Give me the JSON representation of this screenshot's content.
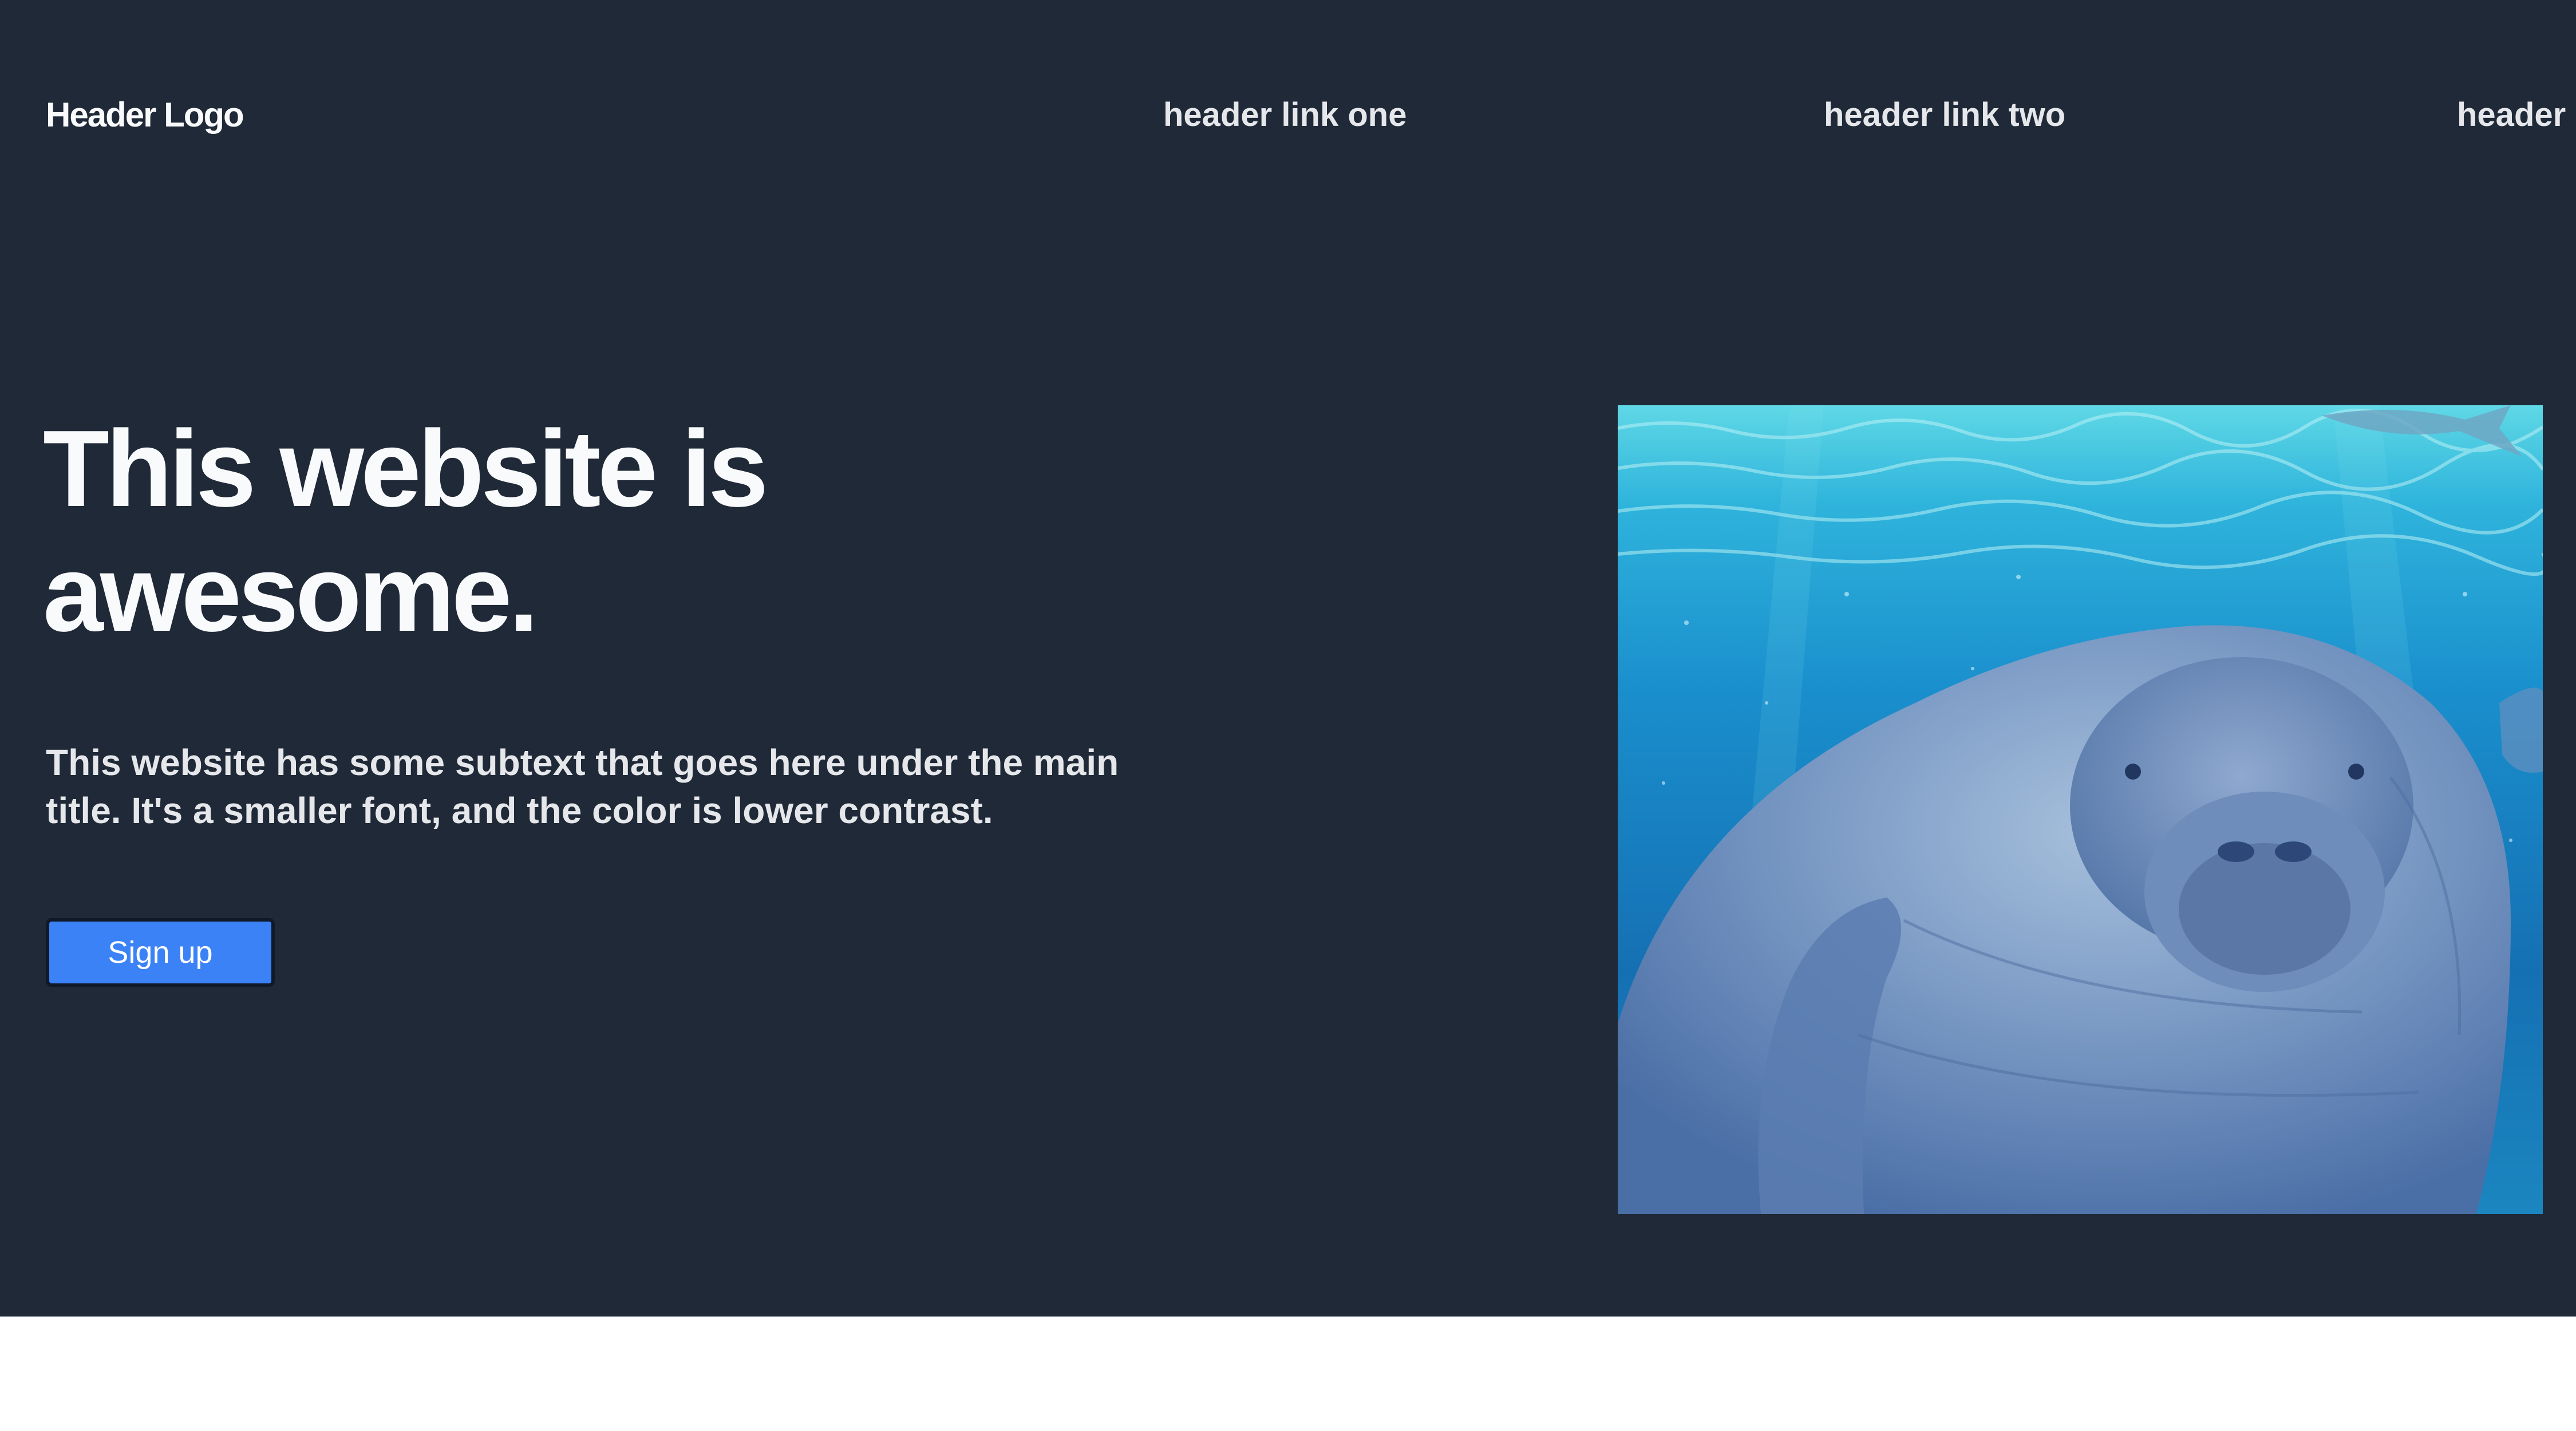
{
  "header": {
    "logo": "Header Logo",
    "links": [
      {
        "label": "header link one"
      },
      {
        "label": "header link two"
      },
      {
        "label": "header"
      }
    ]
  },
  "hero": {
    "title": "This website is awesome.",
    "subtitle": "This website has some subtext that goes here under the main title. It's a smaller font, and the color is lower contrast.",
    "cta_label": "Sign up",
    "image_subject": "manatee swimming underwater"
  },
  "colors": {
    "background": "#1f2937",
    "accent": "#3b82f6",
    "text": "#f9fafb",
    "subtext": "#e5e7eb"
  }
}
